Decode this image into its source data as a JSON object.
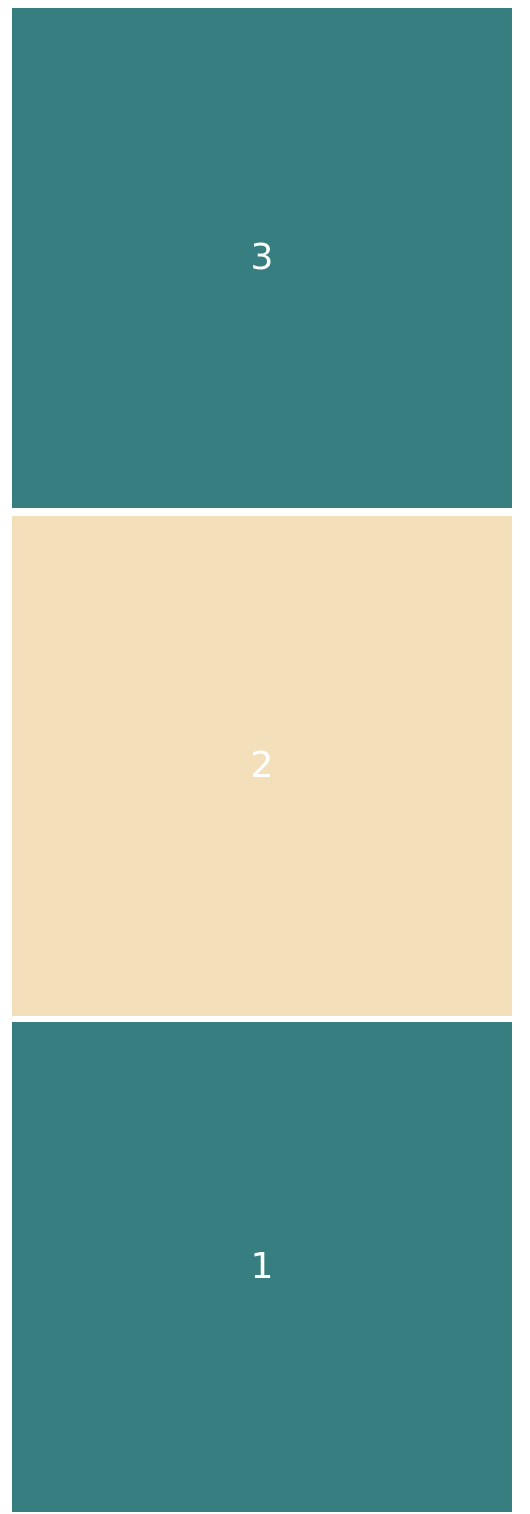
{
  "tiles": [
    {
      "label": "3",
      "color": "#367e7f"
    },
    {
      "label": "2",
      "color": "#f3dfba"
    },
    {
      "label": "1",
      "color": "#367e7f"
    }
  ]
}
